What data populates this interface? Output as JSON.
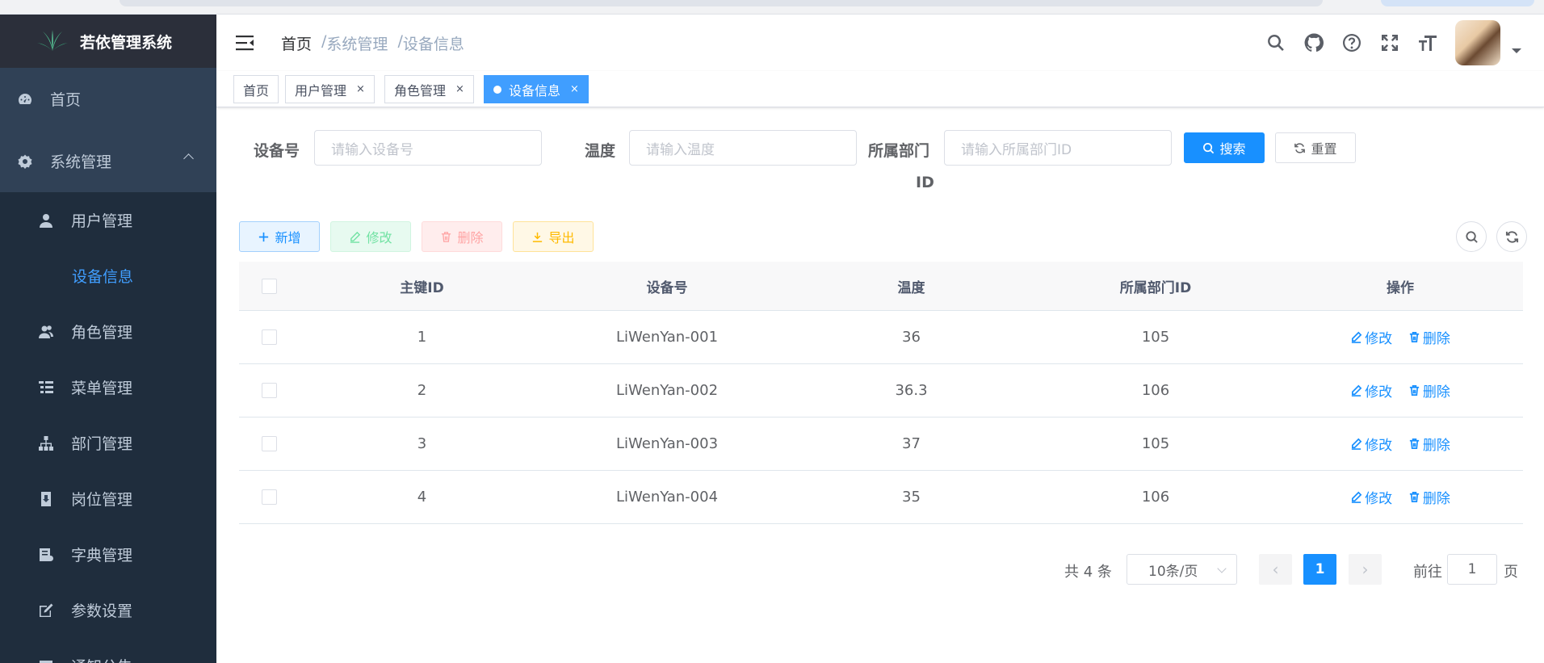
{
  "app": {
    "title": "若依管理系统"
  },
  "sidebar": {
    "items": [
      {
        "label": "首页",
        "icon": "dashboard-icon"
      },
      {
        "label": "系统管理",
        "icon": "gear-icon",
        "expanded": true
      }
    ],
    "subitems": [
      {
        "label": "用户管理",
        "icon": "user-icon"
      },
      {
        "label": "设备信息",
        "icon": "",
        "active": true
      },
      {
        "label": "角色管理",
        "icon": "peoples-icon"
      },
      {
        "label": "菜单管理",
        "icon": "tree-table-icon"
      },
      {
        "label": "部门管理",
        "icon": "tree-icon"
      },
      {
        "label": "岗位管理",
        "icon": "post-icon"
      },
      {
        "label": "字典管理",
        "icon": "dict-icon"
      },
      {
        "label": "参数设置",
        "icon": "edit-icon"
      },
      {
        "label": "通知公告",
        "icon": "message-icon"
      }
    ]
  },
  "breadcrumb": {
    "home": "首页",
    "sep": "/",
    "level1": "系统管理",
    "level2": "设备信息"
  },
  "tags": [
    {
      "label": "首页",
      "closable": false
    },
    {
      "label": "用户管理",
      "closable": true,
      "close": "×"
    },
    {
      "label": "角色管理",
      "closable": true,
      "close": "×"
    },
    {
      "label": "设备信息",
      "closable": true,
      "close": "×",
      "active": true
    }
  ],
  "search": {
    "device_label": "设备号",
    "device_placeholder": "请输入设备号",
    "temp_label": "温度",
    "temp_placeholder": "请输入温度",
    "dept_label_line1": "所属部门",
    "dept_label_line2": "ID",
    "dept_placeholder": "请输入所属部门ID",
    "search_btn": "搜索",
    "reset_btn": "重置"
  },
  "toolbar": {
    "add": "新增",
    "edit": "修改",
    "delete": "删除",
    "export": "导出"
  },
  "table": {
    "headers": [
      "主键ID",
      "设备号",
      "温度",
      "所属部门ID",
      "操作"
    ],
    "rows": [
      {
        "id": "1",
        "device": "LiWenYan-001",
        "temp": "36",
        "dept": "105"
      },
      {
        "id": "2",
        "device": "LiWenYan-002",
        "temp": "36.3",
        "dept": "106"
      },
      {
        "id": "3",
        "device": "LiWenYan-003",
        "temp": "37",
        "dept": "105"
      },
      {
        "id": "4",
        "device": "LiWenYan-004",
        "temp": "35",
        "dept": "106"
      }
    ],
    "op_edit": "修改",
    "op_delete": "删除"
  },
  "pagination": {
    "total": "共 4 条",
    "page_size": "10条/页",
    "current": "1",
    "goto_label": "前往",
    "goto_value": "1",
    "page_suffix": "页"
  },
  "colors": {
    "primary": "#1890ff",
    "sidebar_bg": "#304156",
    "submenu_bg": "#1f2d3d",
    "active_menu": "#409eff"
  }
}
